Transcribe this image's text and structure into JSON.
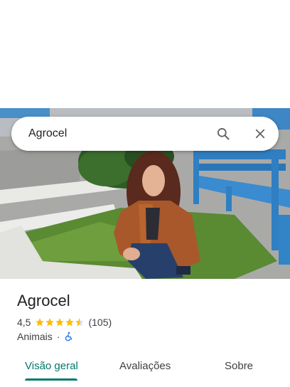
{
  "search": {
    "query": "Agrocel",
    "search_icon": "search-icon",
    "close_icon": "close-icon"
  },
  "place": {
    "name": "Agrocel",
    "rating": "4,5",
    "stars": 4.5,
    "review_count": "(105)",
    "category": "Animais",
    "separator": "·",
    "accessibility_icon": "wheelchair-icon"
  },
  "tabs": [
    {
      "label": "Visão geral",
      "active": true
    },
    {
      "label": "Avaliações",
      "active": false
    },
    {
      "label": "Sobre",
      "active": false
    }
  ],
  "colors": {
    "accent": "#00796b",
    "star": "#fbbc04",
    "accessibility": "#1a73e8"
  }
}
